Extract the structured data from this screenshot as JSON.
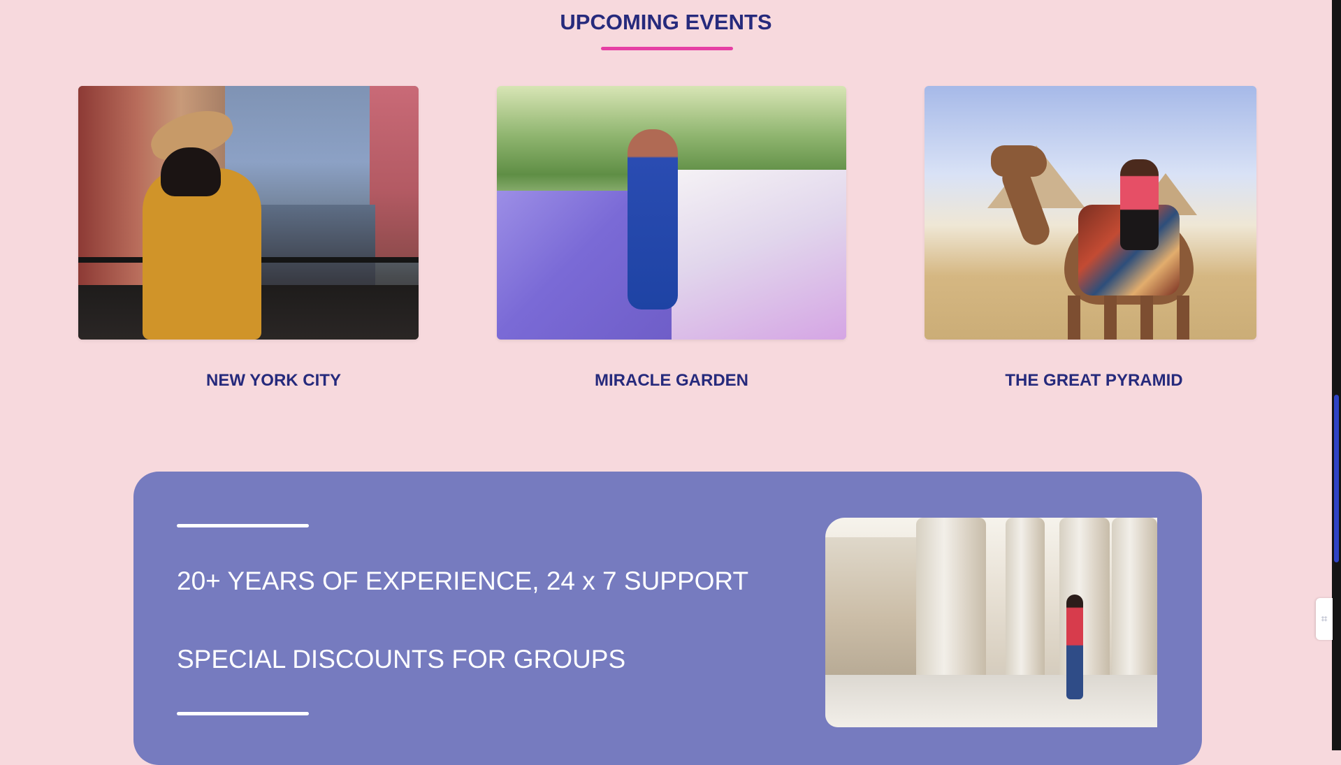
{
  "page": {
    "section_title": "UPCOMING EVENTS",
    "colors": {
      "background": "#f7d9dd",
      "heading": "#262a7c",
      "accent_line": "#e63fa4",
      "promo_panel": "#767bbf",
      "scrollbar_thumb": "#2f43c5"
    }
  },
  "events": [
    {
      "title": "NEW YORK CITY",
      "image_icon": "photo-city-traveler"
    },
    {
      "title": "MIRACLE GARDEN",
      "image_icon": "photo-flower-garden"
    },
    {
      "title": "THE GREAT PYRAMID",
      "image_icon": "photo-pyramid-camel"
    }
  ],
  "promo": {
    "line1": "20+ YEARS OF EXPERIENCE, 24 x 7 SUPPORT",
    "line2": "SPECIAL DISCOUNTS FOR GROUPS",
    "image_icon": "photo-columns-tourist"
  },
  "sidebar_widget": {
    "icon": "handle-icon"
  }
}
